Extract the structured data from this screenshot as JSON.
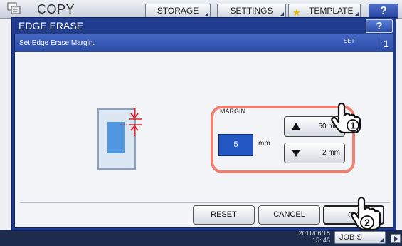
{
  "header": {
    "app_title": "COPY",
    "storage_label": "STORAGE",
    "settings_label": "SETTINGS",
    "template_label": "TEMPLATE",
    "help_label": "?"
  },
  "dialog": {
    "title": "EDGE ERASE",
    "help_label": "?",
    "instruction": "Set Edge Erase Margin.",
    "set_label": "SET",
    "set_number": "1"
  },
  "margin": {
    "label": "MARGIN",
    "value": "5",
    "unit": "mm",
    "max_label": "50 mm",
    "min_label": "2 mm"
  },
  "actions": {
    "reset_label": "RESET",
    "cancel_label": "CANCEL",
    "ok_label": "OK"
  },
  "footer": {
    "date_partial": "2011/06/15",
    "time": "15: 45",
    "job_status_label": "JOB S"
  },
  "callouts": {
    "step_1": "1",
    "step_2": "2"
  },
  "colors": {
    "dialog_blue": "#1f3c8e",
    "value_box_blue": "#2557c4",
    "highlight_ring": "#ef8070",
    "paper_image": "#4f97e0",
    "margin_arrow_red": "#e0202a"
  },
  "icons": [
    "copy-icon",
    "star-icon",
    "up-arrow-icon",
    "down-arrow-icon",
    "margin-arrows-icon",
    "hand-pointer-icon"
  ]
}
